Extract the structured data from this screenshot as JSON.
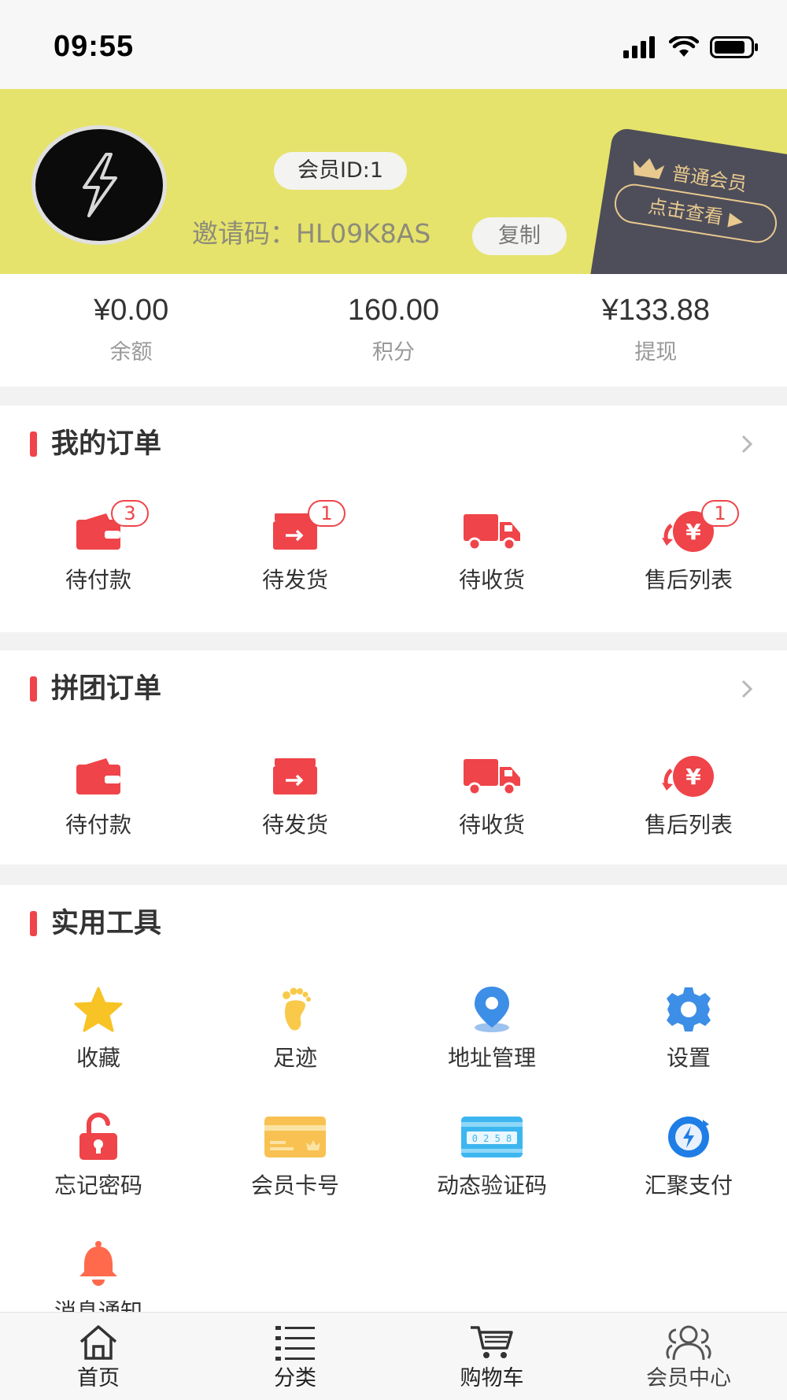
{
  "status_bar": {
    "time": "09:55"
  },
  "profile": {
    "member_id": "会员ID:1",
    "invite_label": "邀请码：",
    "invite_code": "HL09K8AS",
    "copy_label": "复制",
    "vip_level": "普通会员",
    "vip_view_label": "点击查看 ▶",
    "colors": {
      "header_bg": "#e6e36c",
      "vip_card": "#4e4e5a",
      "vip_gold": "#e8c98e"
    }
  },
  "stats": [
    {
      "value": "¥0.00",
      "label": "余额"
    },
    {
      "value": "160.00",
      "label": "积分"
    },
    {
      "value": "¥133.88",
      "label": "提现"
    }
  ],
  "my_orders": {
    "title": "我的订单",
    "items": [
      {
        "label": "待付款",
        "icon": "wallet-icon",
        "badge": "3"
      },
      {
        "label": "待发货",
        "icon": "box-icon",
        "badge": "1"
      },
      {
        "label": "待收货",
        "icon": "truck-icon",
        "badge": ""
      },
      {
        "label": "售后列表",
        "icon": "refund-icon",
        "badge": "1"
      }
    ]
  },
  "group_orders": {
    "title": "拼团订单",
    "items": [
      {
        "label": "待付款",
        "icon": "wallet-icon"
      },
      {
        "label": "待发货",
        "icon": "box-icon"
      },
      {
        "label": "待收货",
        "icon": "truck-icon"
      },
      {
        "label": "售后列表",
        "icon": "refund-icon"
      }
    ]
  },
  "tools": {
    "title": "实用工具",
    "items": [
      {
        "label": "收藏",
        "icon": "star-icon"
      },
      {
        "label": "足迹",
        "icon": "footprint-icon"
      },
      {
        "label": "地址管理",
        "icon": "location-pin-icon"
      },
      {
        "label": "设置",
        "icon": "gear-icon"
      },
      {
        "label": "忘记密码",
        "icon": "unlock-icon"
      },
      {
        "label": "会员卡号",
        "icon": "member-card-icon"
      },
      {
        "label": "动态验证码",
        "icon": "code-card-icon"
      },
      {
        "label": "汇聚支付",
        "icon": "pay-icon"
      },
      {
        "label": "消息通知",
        "icon": "bell-icon"
      }
    ]
  },
  "tabbar": [
    {
      "label": "首页",
      "icon": "home-icon"
    },
    {
      "label": "分类",
      "icon": "list-icon"
    },
    {
      "label": "购物车",
      "icon": "cart-icon"
    },
    {
      "label": "会员中心",
      "icon": "user-group-icon"
    }
  ],
  "accent_color": "#ef4449"
}
